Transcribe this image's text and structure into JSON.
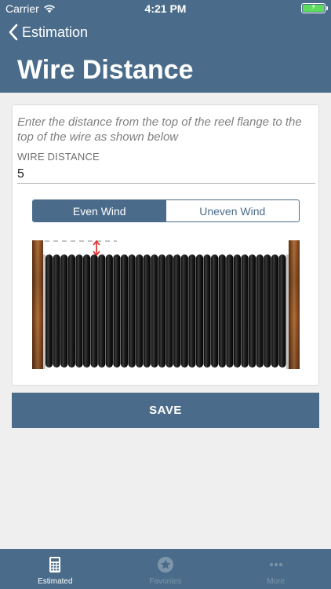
{
  "status_bar": {
    "carrier": "Carrier",
    "time": "4:21 PM"
  },
  "nav": {
    "back_label": "Estimation",
    "title": "Wire Distance"
  },
  "form": {
    "instruction": "Enter the distance from the top of the reel flange to the top of the wire as shown below",
    "field_label": "WIRE DISTANCE",
    "field_value": "5"
  },
  "segments": [
    {
      "label": "Even Wind",
      "selected": true
    },
    {
      "label": "Uneven Wind",
      "selected": false
    }
  ],
  "save_label": "SAVE",
  "tabs": [
    {
      "label": "Estimated",
      "icon": "calculator-icon",
      "active": true
    },
    {
      "label": "Favorites",
      "icon": "star-icon",
      "active": false
    },
    {
      "label": "More",
      "icon": "more-icon",
      "active": false
    }
  ],
  "colors": {
    "primary": "#4a6c8a",
    "background": "#efefef",
    "battery": "#5cdb5c",
    "indicator": "#e02020",
    "wire": "#1a1a1a",
    "flange": "#8a4a1e"
  }
}
